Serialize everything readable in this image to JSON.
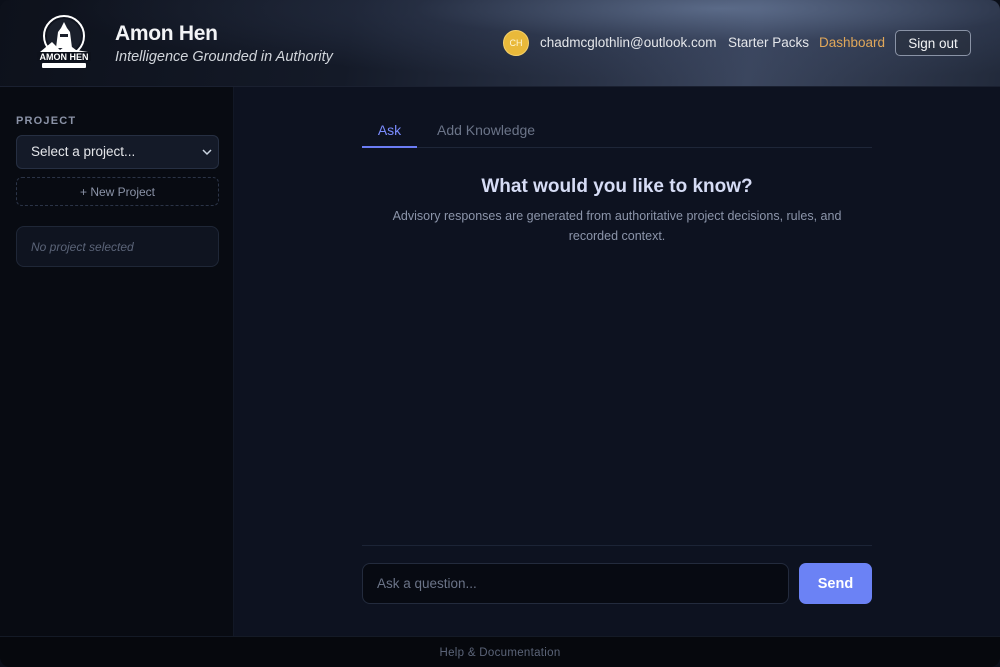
{
  "header": {
    "logo_text": "AMON HEN",
    "title": "Amon Hen",
    "tagline": "Intelligence Grounded in Authority",
    "user": {
      "initials": "CH",
      "email": "chadmcglothlin@outlook.com",
      "avatar_color": "#e9b93a"
    },
    "nav": {
      "starter_packs": "Starter Packs",
      "dashboard": "Dashboard",
      "dashboard_color": "#e0a75a"
    },
    "sign_out_label": "Sign out"
  },
  "sidebar": {
    "section_label": "PROJECT",
    "project_select": {
      "selected": "Select a project...",
      "icon": "chevron-down-icon"
    },
    "new_project_label": "+ New Project",
    "empty_state": "No project selected"
  },
  "main": {
    "tabs": [
      {
        "label": "Ask",
        "active": true
      },
      {
        "label": "Add Knowledge",
        "active": false
      }
    ],
    "prompt_title": "What would you like to know?",
    "prompt_subtitle": "Advisory responses are generated from authoritative project decisions, rules, and recorded context.",
    "input": {
      "value": "",
      "placeholder": "Ask a question..."
    },
    "send_label": "Send",
    "accent_color": "#6b82f5"
  },
  "footer": {
    "link_label": "Help & Documentation"
  }
}
